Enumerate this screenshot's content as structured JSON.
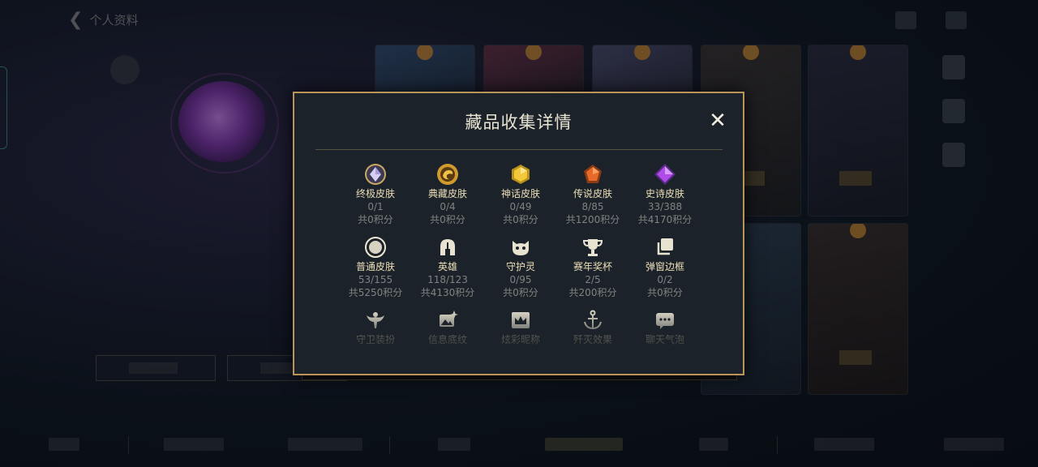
{
  "background": {
    "back_label": "个人资料",
    "tab_labels": [
      "",
      "",
      "",
      "",
      "",
      "",
      "",
      ""
    ]
  },
  "modal": {
    "title": "藏品收集详情",
    "close_symbol": "✕",
    "items": [
      {
        "label": "终极皮肤",
        "count": "0/1",
        "score": "共0积分",
        "icon": "crystal-white-icon"
      },
      {
        "label": "典藏皮肤",
        "count": "0/4",
        "score": "共0积分",
        "icon": "dragon-emblem-icon"
      },
      {
        "label": "神话皮肤",
        "count": "0/49",
        "score": "共0积分",
        "icon": "gem-gold-icon"
      },
      {
        "label": "传说皮肤",
        "count": "8/85",
        "score": "共1200积分",
        "icon": "gem-orange-icon"
      },
      {
        "label": "史诗皮肤",
        "count": "33/388",
        "score": "共4170积分",
        "icon": "gem-purple-icon"
      },
      {
        "label": "普通皮肤",
        "count": "53/155",
        "score": "共5250积分",
        "icon": "circle-icon"
      },
      {
        "label": "英雄",
        "count": "118/123",
        "score": "共4130积分",
        "icon": "helmet-icon"
      },
      {
        "label": "守护灵",
        "count": "0/95",
        "score": "共0积分",
        "icon": "guardian-creature-icon"
      },
      {
        "label": "赛年奖杯",
        "count": "2/5",
        "score": "共200积分",
        "icon": "trophy-icon"
      },
      {
        "label": "弹窗边框",
        "count": "0/2",
        "score": "共0积分",
        "icon": "layered-frame-icon"
      },
      {
        "label": "守卫装扮",
        "icon": "ward-icon"
      },
      {
        "label": "信息底纹",
        "icon": "image-sparkle-icon"
      },
      {
        "label": "炫彩昵称",
        "icon": "crown-frame-icon"
      },
      {
        "label": "歼灭效果",
        "icon": "anchor-icon"
      },
      {
        "label": "聊天气泡",
        "icon": "chat-bubble-icon"
      }
    ]
  }
}
